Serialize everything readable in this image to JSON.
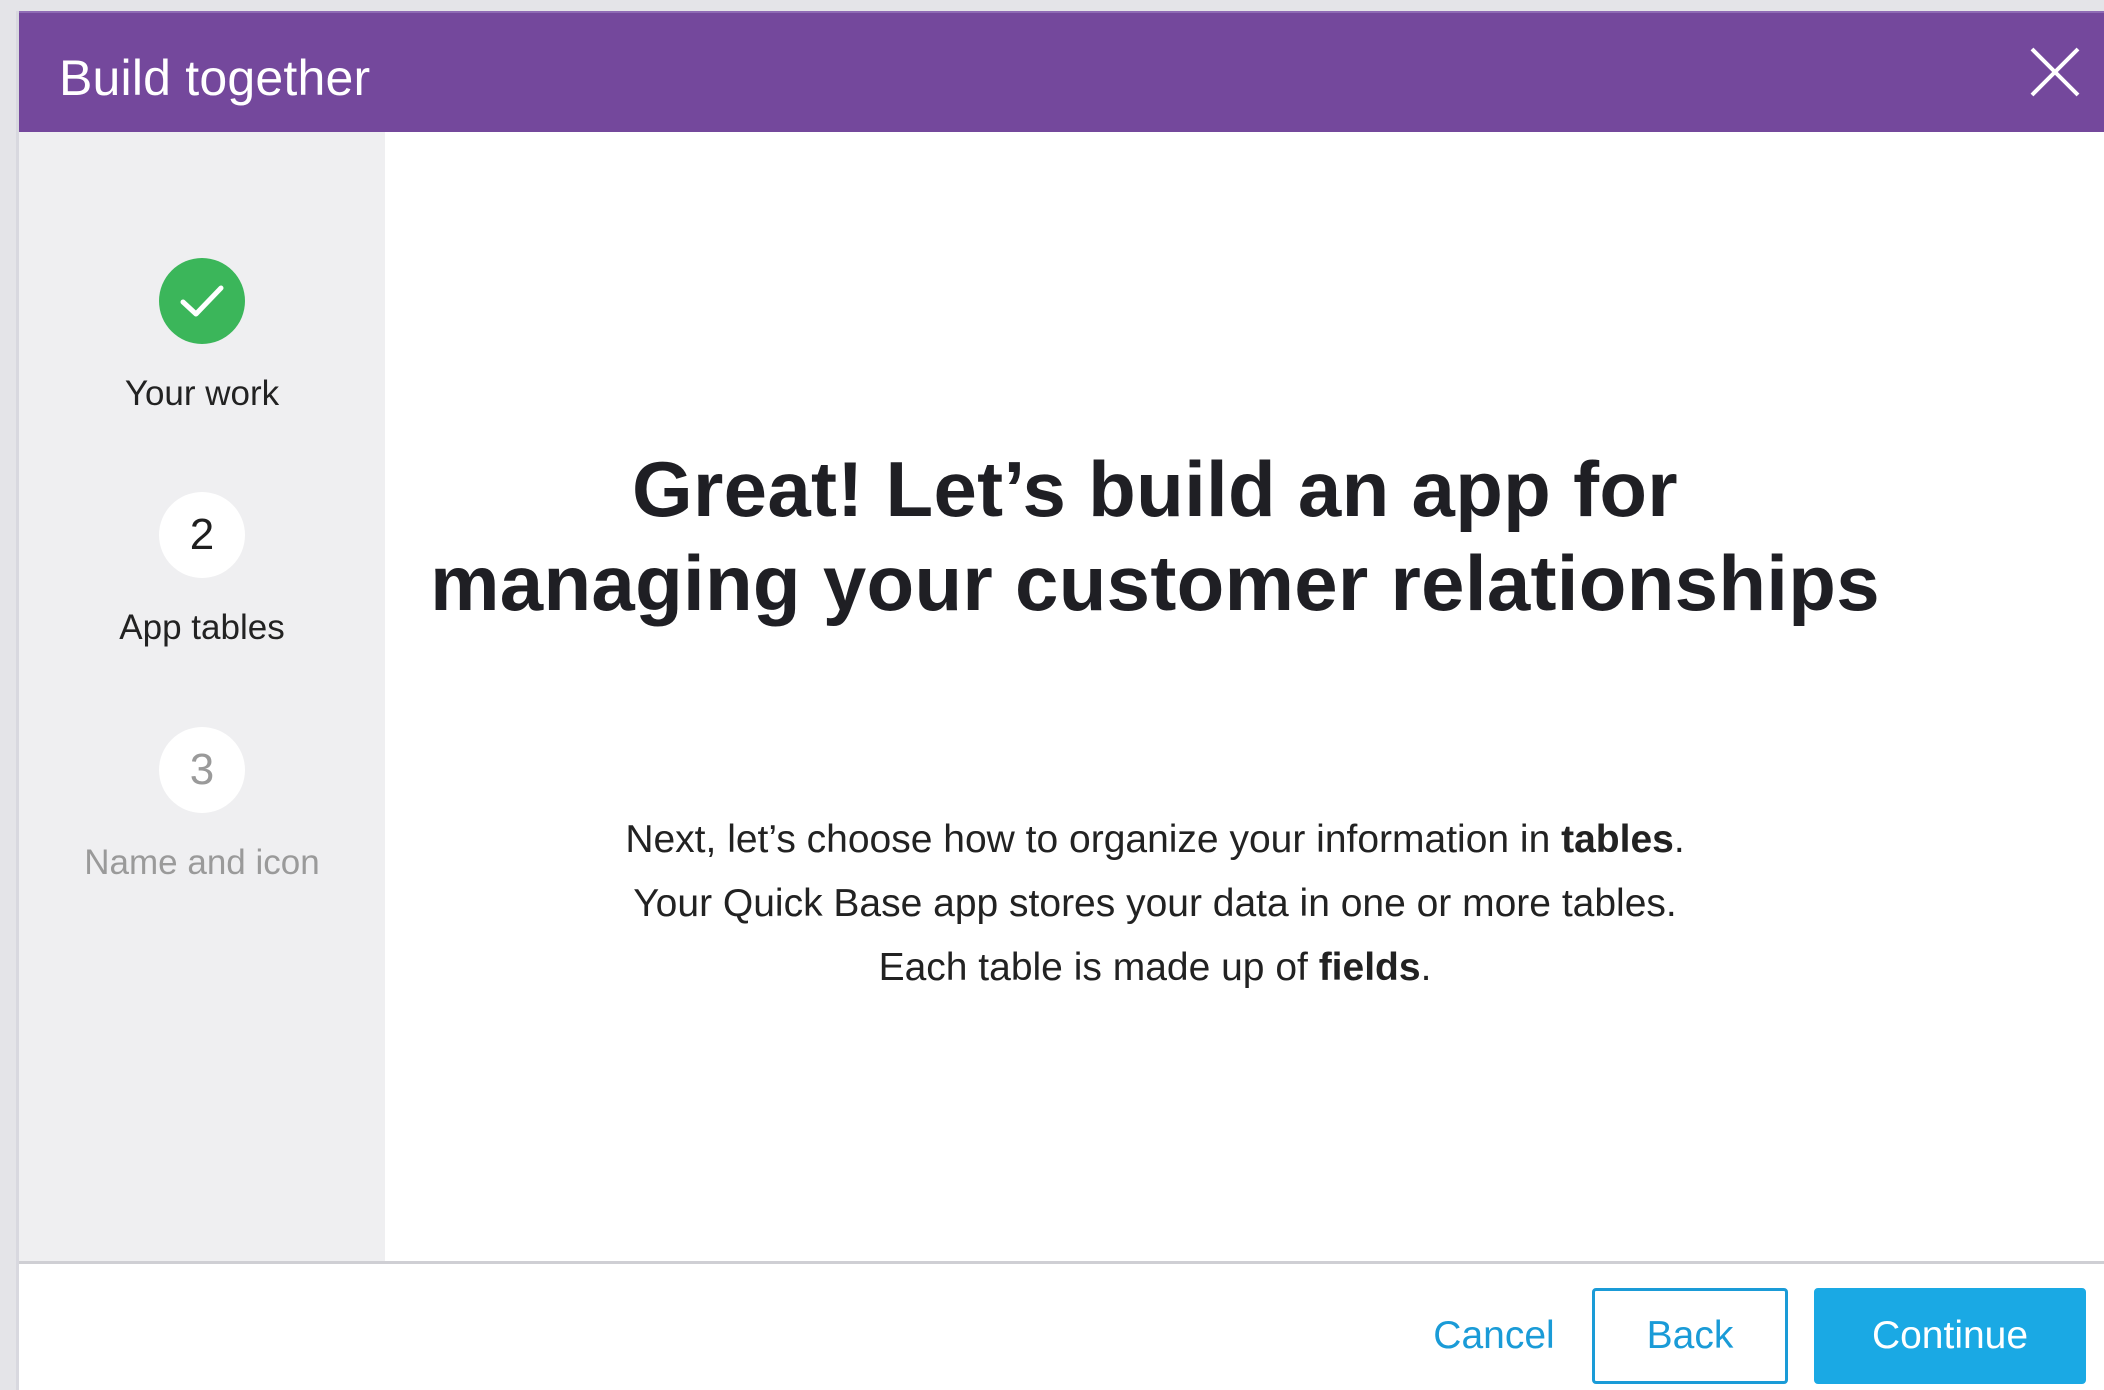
{
  "dialog": {
    "title": "Build together"
  },
  "steps": [
    {
      "number": "",
      "label": "Your work",
      "state": "done"
    },
    {
      "number": "2",
      "label": "App tables",
      "state": "current"
    },
    {
      "number": "3",
      "label": "Name and icon",
      "state": "future"
    }
  ],
  "main": {
    "headline_line1": "Great! Let’s build an app for",
    "headline_line2": "managing your customer relationships",
    "body": {
      "line1_prefix": "Next, let’s choose how to organize your information in ",
      "line1_bold": "tables",
      "line1_suffix": ".",
      "line2": "Your Quick Base app stores your data in one or more tables.",
      "line3_prefix": "Each table is made up of ",
      "line3_bold": "fields",
      "line3_suffix": "."
    }
  },
  "footer": {
    "cancel_label": "Cancel",
    "back_label": "Back",
    "continue_label": "Continue"
  },
  "colors": {
    "header": "#74489c",
    "success": "#3bb65a",
    "accent": "#1aa9e4",
    "link": "#1a9bd7"
  }
}
